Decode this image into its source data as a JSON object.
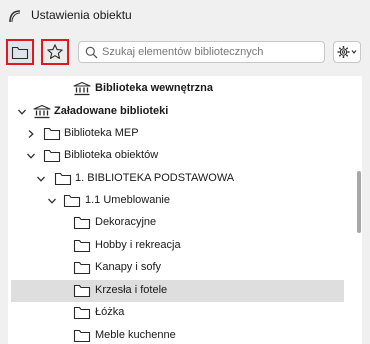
{
  "window": {
    "title": "Ustawienia obiektu"
  },
  "toolbar": {
    "folder_button_icon": "folder-icon",
    "favorites_button_icon": "star-icon",
    "search_placeholder": "Szukaj elementów bibliotecznych",
    "settings_icon": "gear-icon",
    "highlight_color": "#e0191f"
  },
  "tree": {
    "selected_color": "#dedede",
    "rows": [
      {
        "label": "Biblioteka wewnętrzna",
        "bold": true,
        "icon": "library-icon",
        "expander": "none"
      },
      {
        "label": "Załadowane biblioteki",
        "bold": true,
        "icon": "library-icon",
        "expander": "expanded"
      },
      {
        "label": "Biblioteka MEP",
        "bold": false,
        "icon": "folder-icon",
        "expander": "collapsed"
      },
      {
        "label": "Biblioteka obiektów",
        "bold": false,
        "icon": "folder-icon",
        "expander": "expanded"
      },
      {
        "label": "1. BIBLIOTEKA PODSTAWOWA",
        "bold": false,
        "icon": "folder-icon",
        "expander": "expanded"
      },
      {
        "label": "1.1 Umeblowanie",
        "bold": false,
        "icon": "folder-icon",
        "expander": "expanded"
      },
      {
        "label": "Dekoracyjne",
        "bold": false,
        "icon": "folder-icon",
        "expander": "none"
      },
      {
        "label": "Hobby i rekreacja",
        "bold": false,
        "icon": "folder-icon",
        "expander": "none"
      },
      {
        "label": "Kanapy i sofy",
        "bold": false,
        "icon": "folder-icon",
        "expander": "none"
      },
      {
        "label": "Krzesła i fotele",
        "bold": false,
        "icon": "folder-icon",
        "expander": "none",
        "selected": true
      },
      {
        "label": "Łóżka",
        "bold": false,
        "icon": "folder-icon",
        "expander": "none"
      },
      {
        "label": "Meble kuchenne",
        "bold": false,
        "icon": "folder-icon",
        "expander": "none"
      }
    ]
  }
}
